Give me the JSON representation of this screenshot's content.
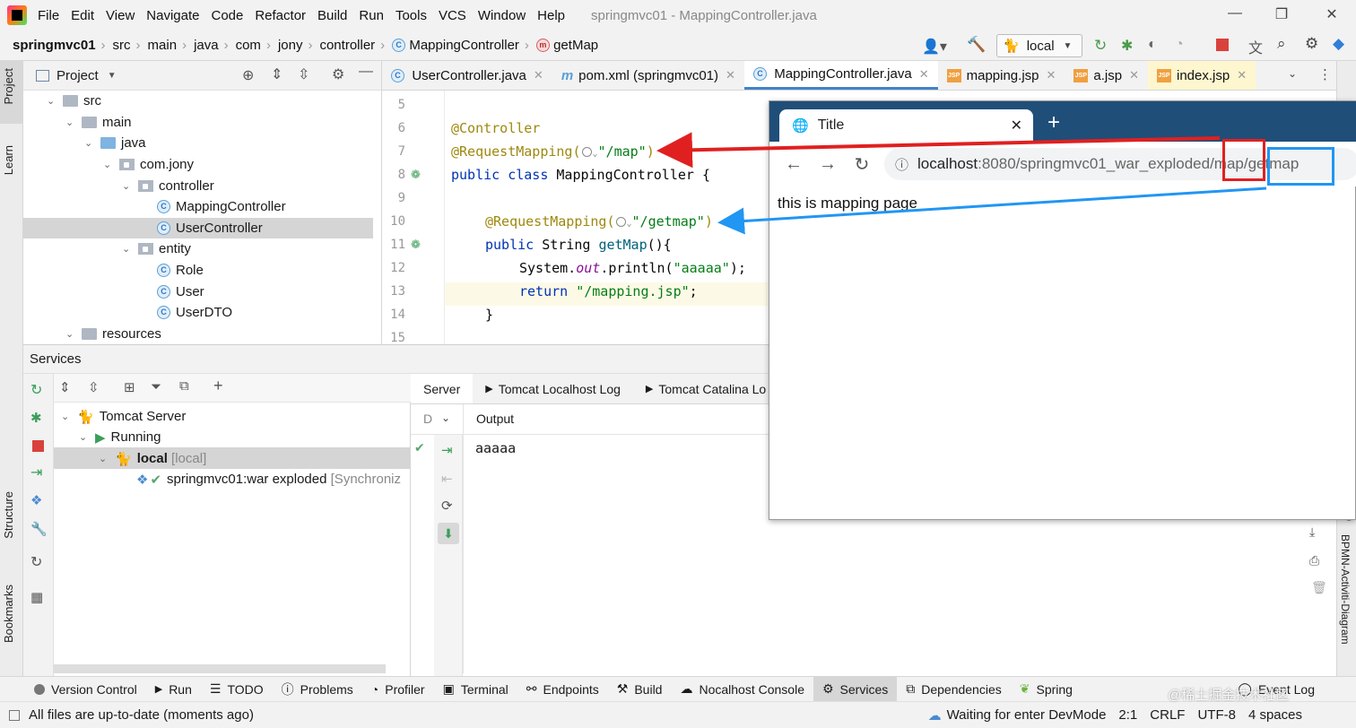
{
  "window": {
    "title": "springmvc01 - MappingController.java",
    "menu": [
      "File",
      "Edit",
      "View",
      "Navigate",
      "Code",
      "Refactor",
      "Build",
      "Run",
      "Tools",
      "VCS",
      "Window",
      "Help"
    ]
  },
  "nav": {
    "crumbs": [
      "springmvc01",
      "src",
      "main",
      "java",
      "com",
      "jony",
      "controller",
      "MappingController",
      "getMap"
    ],
    "run_config": "local"
  },
  "left_stripe": [
    "Project",
    "Learn",
    "Structure",
    "Bookmarks"
  ],
  "right_stripe": [
    "BPMN-Activiti-Diagram"
  ],
  "project": {
    "title": "Project",
    "tree": [
      {
        "label": "src",
        "depth": 0,
        "kind": "folder",
        "open": true
      },
      {
        "label": "main",
        "depth": 1,
        "kind": "folder",
        "open": true
      },
      {
        "label": "java",
        "depth": 2,
        "kind": "folder-blue",
        "open": true
      },
      {
        "label": "com.jony",
        "depth": 3,
        "kind": "package",
        "open": true
      },
      {
        "label": "controller",
        "depth": 4,
        "kind": "package",
        "open": true
      },
      {
        "label": "MappingController",
        "depth": 5,
        "kind": "class"
      },
      {
        "label": "UserController",
        "depth": 5,
        "kind": "class",
        "selected": true
      },
      {
        "label": "entity",
        "depth": 4,
        "kind": "package",
        "open": true
      },
      {
        "label": "Role",
        "depth": 5,
        "kind": "class"
      },
      {
        "label": "User",
        "depth": 5,
        "kind": "class"
      },
      {
        "label": "UserDTO",
        "depth": 5,
        "kind": "class"
      },
      {
        "label": "resources",
        "depth": 1,
        "kind": "folder",
        "open": true
      }
    ]
  },
  "editor": {
    "tabs": [
      {
        "label": "UserController.java",
        "icon": "class"
      },
      {
        "label": "pom.xml (springmvc01)",
        "icon": "maven"
      },
      {
        "label": "MappingController.java",
        "icon": "class",
        "active": true
      },
      {
        "label": "mapping.jsp",
        "icon": "jsp"
      },
      {
        "label": "a.jsp",
        "icon": "jsp"
      },
      {
        "label": "index.jsp",
        "icon": "jsp"
      }
    ],
    "lines": [
      "5",
      "6",
      "7",
      "8",
      "9",
      "10",
      "11",
      "12",
      "13",
      "14",
      "15"
    ],
    "code": {
      "l6": "@Controller",
      "l7_pre": "@RequestMapping(",
      "l7_str": "\"/map\"",
      "l7_post": ")",
      "l8_kw": "public class ",
      "l8_rest": "MappingController {",
      "l10_pre": "@RequestMapping(",
      "l10_str": "\"/getmap\"",
      "l10_post": ")",
      "l11_kw": "public ",
      "l11_type": "String ",
      "l11_meth": "getMap",
      "l11_rest": "(){",
      "l12_pre": "System.",
      "l12_fld": "out",
      "l12_mid": ".println(",
      "l12_str": "\"aaaaa\"",
      "l12_post": ");",
      "l13_kw": "return ",
      "l13_str": "\"/mapping.jsp\"",
      "l13_post": ";",
      "l14": "}"
    }
  },
  "browser": {
    "tab_title": "Title",
    "url_host": "localhost",
    "url_rest": ":8080/springmvc01_war_exploded/map/getmap",
    "content": "this is mapping page",
    "highlight_map": "map",
    "highlight_getmap": "getmap"
  },
  "services": {
    "title": "Services",
    "tree": [
      {
        "label": "Tomcat Server",
        "depth": 0
      },
      {
        "label": "Running",
        "depth": 1
      },
      {
        "label": "local",
        "suffix": "[local]",
        "depth": 2,
        "selected": true
      },
      {
        "label": "springmvc01:war exploded",
        "suffix": "[Synchroniz",
        "depth": 3
      }
    ],
    "output_tabs": [
      "Server",
      "Tomcat Localhost Log",
      "Tomcat Catalina Lo"
    ],
    "output_header": "Output",
    "output_text": "aaaaa"
  },
  "bottom_tabs": [
    "Version Control",
    "Run",
    "TODO",
    "Problems",
    "Profiler",
    "Terminal",
    "Endpoints",
    "Build",
    "Nocalhost Console",
    "Services",
    "Dependencies",
    "Spring",
    "Event Log"
  ],
  "status": {
    "message": "All files are up-to-date (moments ago)",
    "devmode": "Waiting for enter DevMode",
    "position": "2:1",
    "line_sep": "CRLF",
    "encoding": "UTF-8",
    "indent": "4 spaces",
    "watermark": "@稀土掘金技术社区"
  },
  "colors": {
    "accent": "#4083c9",
    "red_box": "#e02020",
    "blue_box": "#2196f3",
    "browser_strip": "#1f4e79"
  }
}
